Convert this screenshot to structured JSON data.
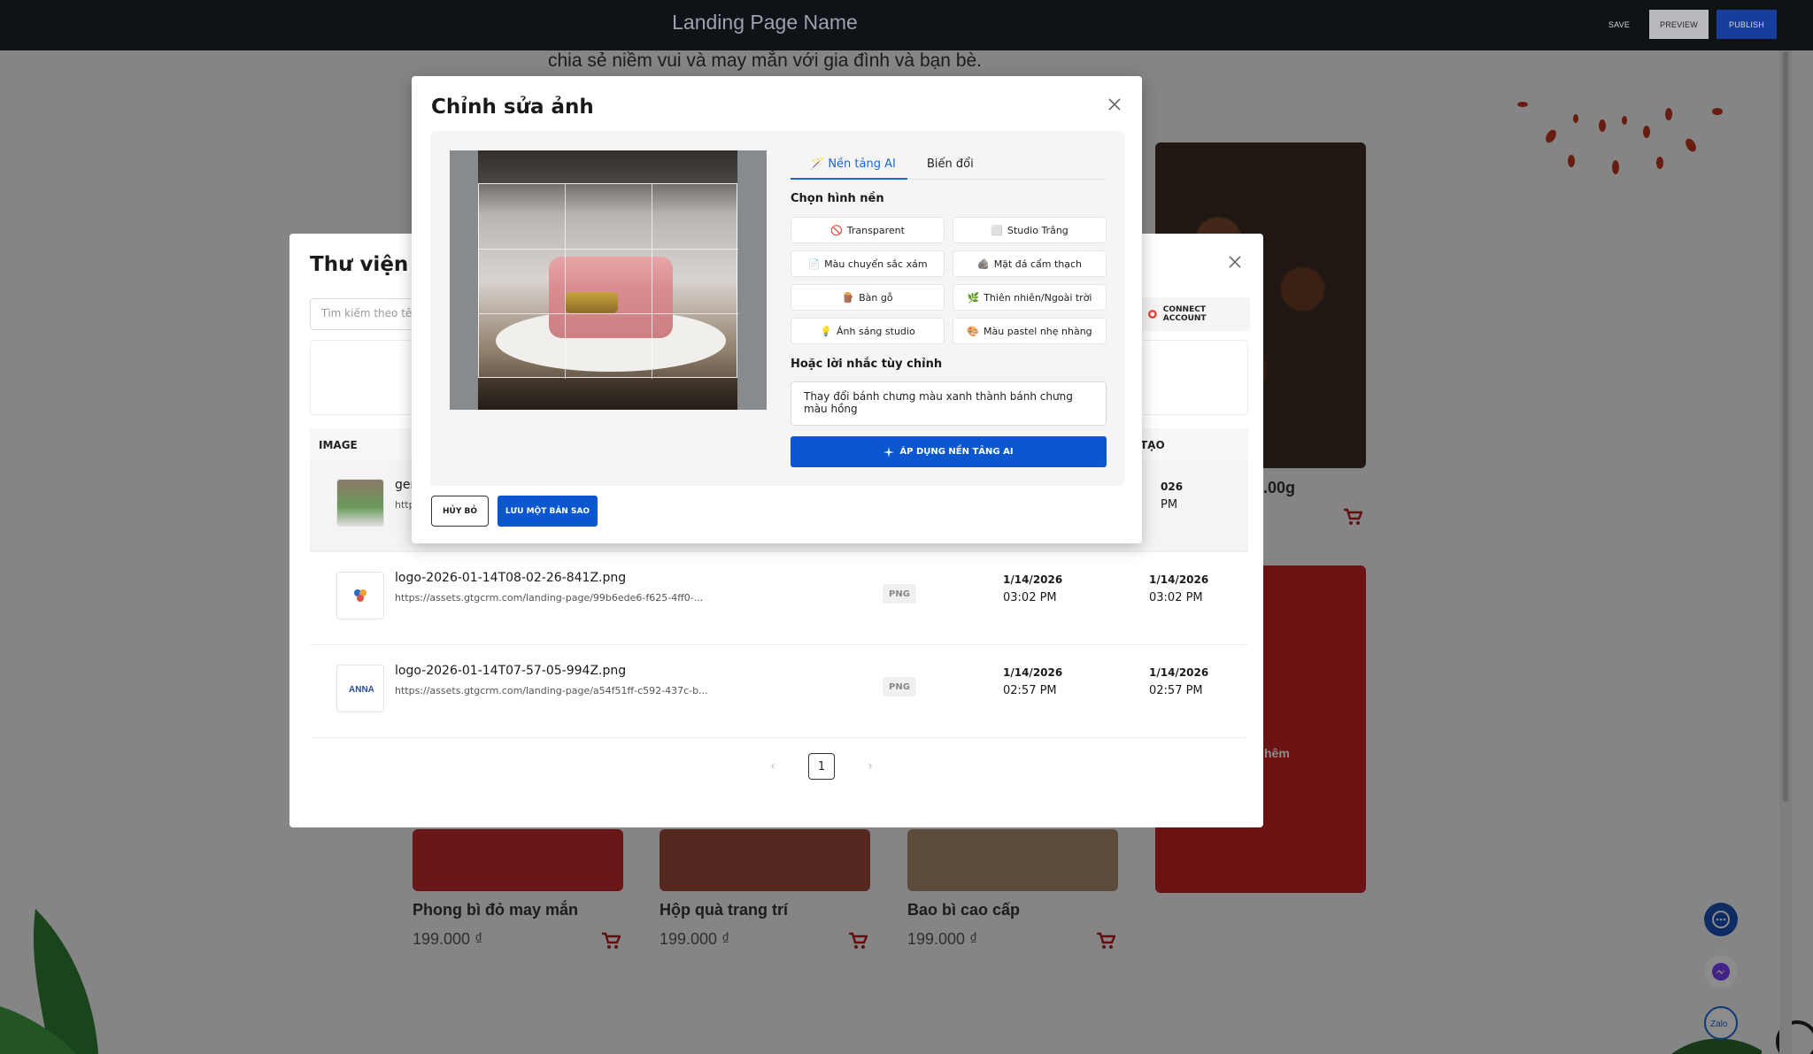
{
  "topbar": {
    "title": "Landing Page Name",
    "save": "SAVE",
    "preview": "PREVIEW",
    "publish": "PUBLISH"
  },
  "page": {
    "intro": "chia sẻ niềm vui và may mắn với gia đình và bạn bè.",
    "products": [
      {
        "name": "Phong bì đỏ may mắn",
        "price": "199.000 ₫"
      },
      {
        "name": "Hộp quà trang trí",
        "price": "199.000 ₫"
      },
      {
        "name": "Bao bì cao cấp",
        "price": "199.000 ₫"
      }
    ],
    "partial_price": ".00g",
    "partial_more": "hêm"
  },
  "library": {
    "title": "Thư viện p",
    "search_placeholder": "Tìm kiếm theo tê",
    "connect_account": "CONNECT ACCOUNT",
    "col_image": "IMAGE",
    "col_created": "TẠO",
    "rows": [
      {
        "name": "ger",
        "url": "http",
        "type": "",
        "date1": "",
        "time1": "",
        "date2": "026",
        "time2": "PM"
      },
      {
        "name": "logo-2026-01-14T08-02-26-841Z.png",
        "url": "https://assets.gtgcrm.com/landing-page/99b6ede6-f625-4ff0-...",
        "type": "PNG",
        "date1": "1/14/2026",
        "time1": "03:02 PM",
        "date2": "1/14/2026",
        "time2": "03:02 PM"
      },
      {
        "name": "logo-2026-01-14T07-57-05-994Z.png",
        "url": "https://assets.gtgcrm.com/landing-page/a54f51ff-c592-437c-b...",
        "type": "PNG",
        "date1": "1/14/2026",
        "time1": "02:57 PM",
        "date2": "1/14/2026",
        "time2": "02:57 PM"
      }
    ],
    "page_current": "1"
  },
  "editor": {
    "title": "Chỉnh sửa ảnh",
    "tabs": [
      "Nền tảng AI",
      "Biến đổi"
    ],
    "choose_bg_label": "Chọn hình nền",
    "bg_options": [
      {
        "icon": "🚫",
        "label": "Transparent"
      },
      {
        "icon": "⬜",
        "label": "Studio Trắng"
      },
      {
        "icon": "📄",
        "label": "Màu chuyển sắc xám"
      },
      {
        "icon": "🪨",
        "label": "Mặt đá cẩm thạch"
      },
      {
        "icon": "🪵",
        "label": "Bàn gỗ"
      },
      {
        "icon": "🌿",
        "label": "Thiên nhiên/Ngoài trời"
      },
      {
        "icon": "💡",
        "label": "Ánh sáng studio"
      },
      {
        "icon": "🎨",
        "label": "Màu pastel nhẹ nhàng"
      }
    ],
    "custom_prompt_label": "Hoặc lời nhắc tùy chỉnh",
    "custom_prompt_value": "Thay đổi bánh chưng màu xanh thành bánh chưng màu hồng",
    "apply_label": "ÁP DỤNG NỀN TẢNG AI",
    "cancel_label": "HỦY BỎ",
    "save_copy_label": "LƯU MỘT BẢN SAO"
  },
  "colors": {
    "primary": "#0b57d0",
    "topbar": "#0f1216",
    "publish": "#173e9b",
    "brand_red": "#c62121"
  }
}
